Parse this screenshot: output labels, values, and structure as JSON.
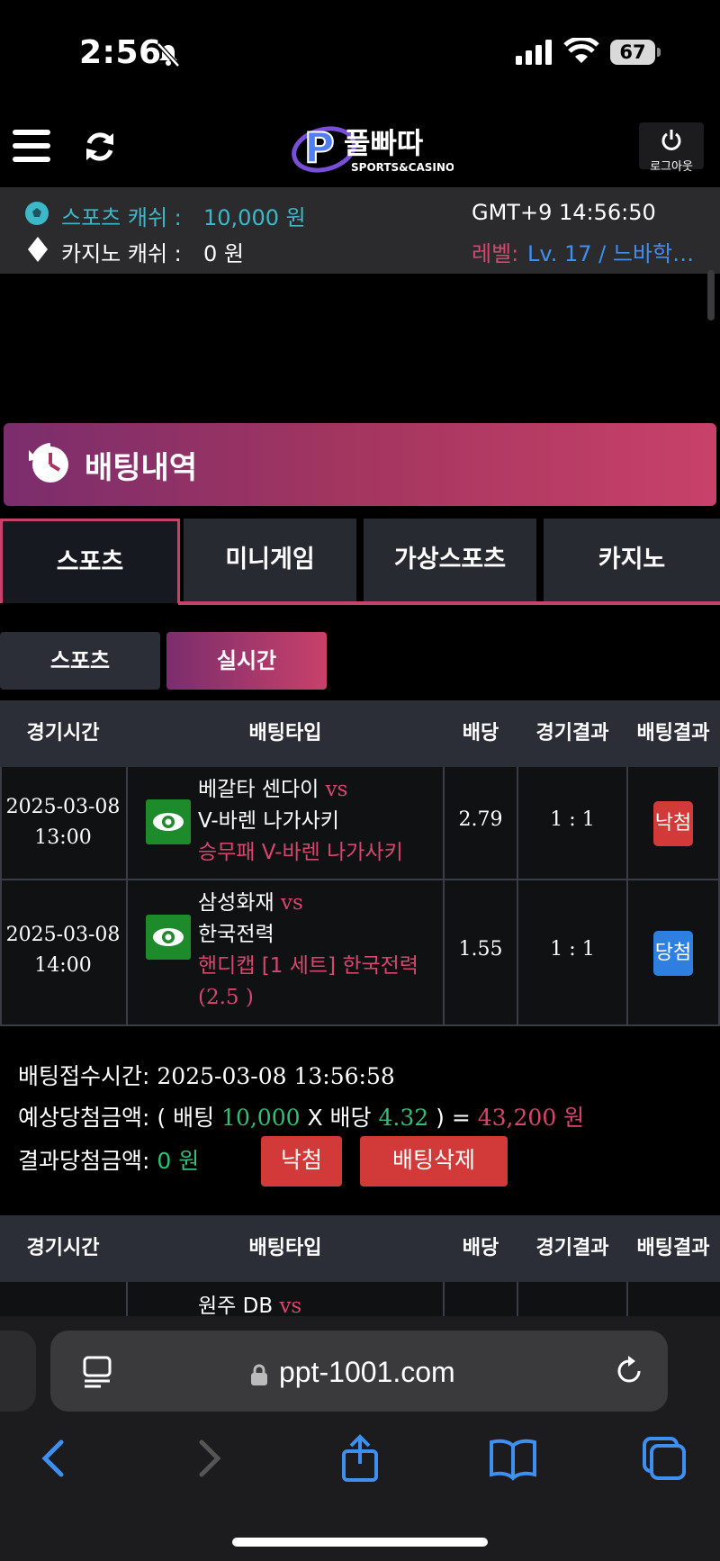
{
  "status_bar": {
    "time": "2:56",
    "battery": "67"
  },
  "header": {
    "logo_text": "풀빠따",
    "logo_sub": "SPORTS&CASINO",
    "logout_label": "로그아웃"
  },
  "cash": {
    "sports_label": "스포츠 캐쉬 :",
    "sports_value": "10,000 원",
    "casino_label": "카지노 캐쉬 :",
    "casino_value": "0 원",
    "clock": "GMT+9 14:56:50",
    "level_label": "레벨:",
    "level_value": "Lv. 17 / 느바학…"
  },
  "section": {
    "title": "배팅내역"
  },
  "tabs": [
    {
      "label": "스포츠",
      "active": true
    },
    {
      "label": "미니게임",
      "active": false
    },
    {
      "label": "가상스포츠",
      "active": false
    },
    {
      "label": "카지노",
      "active": false
    }
  ],
  "subtabs": [
    {
      "label": "스포츠",
      "active": false
    },
    {
      "label": "실시간",
      "active": true
    }
  ],
  "table": {
    "headers": [
      "경기시간",
      "배팅타입",
      "배당",
      "경기결과",
      "배팅결과"
    ],
    "rows": [
      {
        "date": "2025-03-08",
        "time": "13:00",
        "home": "베갈타 센다이",
        "vs": "vs",
        "away": "V-바렌 나가사키",
        "pick": "승무패 V-바렌 나가사키",
        "odds": "2.79",
        "score": "1 : 1",
        "result": "낙첨",
        "result_color": "#d23a3a"
      },
      {
        "date": "2025-03-08",
        "time": "14:00",
        "home": "삼성화재",
        "vs": "vs",
        "away": "한국전력",
        "pick": "핸디캡 [1 세트] 한국전력",
        "pick_line2": "(2.5 )",
        "odds": "1.55",
        "score": "1 : 1",
        "result": "당첨",
        "result_color": "#2f7fe0"
      }
    ]
  },
  "summary": {
    "received_label": "배팅접수시간:",
    "received_value": "2025-03-08 13:56:58",
    "expected_label": "예상당첨금액:",
    "expected_open": "( 배팅",
    "stake": "10,000",
    "x": "X 배당",
    "total_odds": "4.32",
    "expected_close": ") =",
    "expected_amount": "43,200 원",
    "result_label": "결과당첨금액:",
    "result_amount": "0 원",
    "status_button": "낙첨",
    "delete_button": "배팅삭제"
  },
  "table2": {
    "headers": [
      "경기시간",
      "배팅타입",
      "배당",
      "경기결과",
      "배팅결과"
    ],
    "partial_home": "원주 DB",
    "partial_vs": "vs"
  },
  "browser": {
    "url": "ppt-1001.com"
  }
}
